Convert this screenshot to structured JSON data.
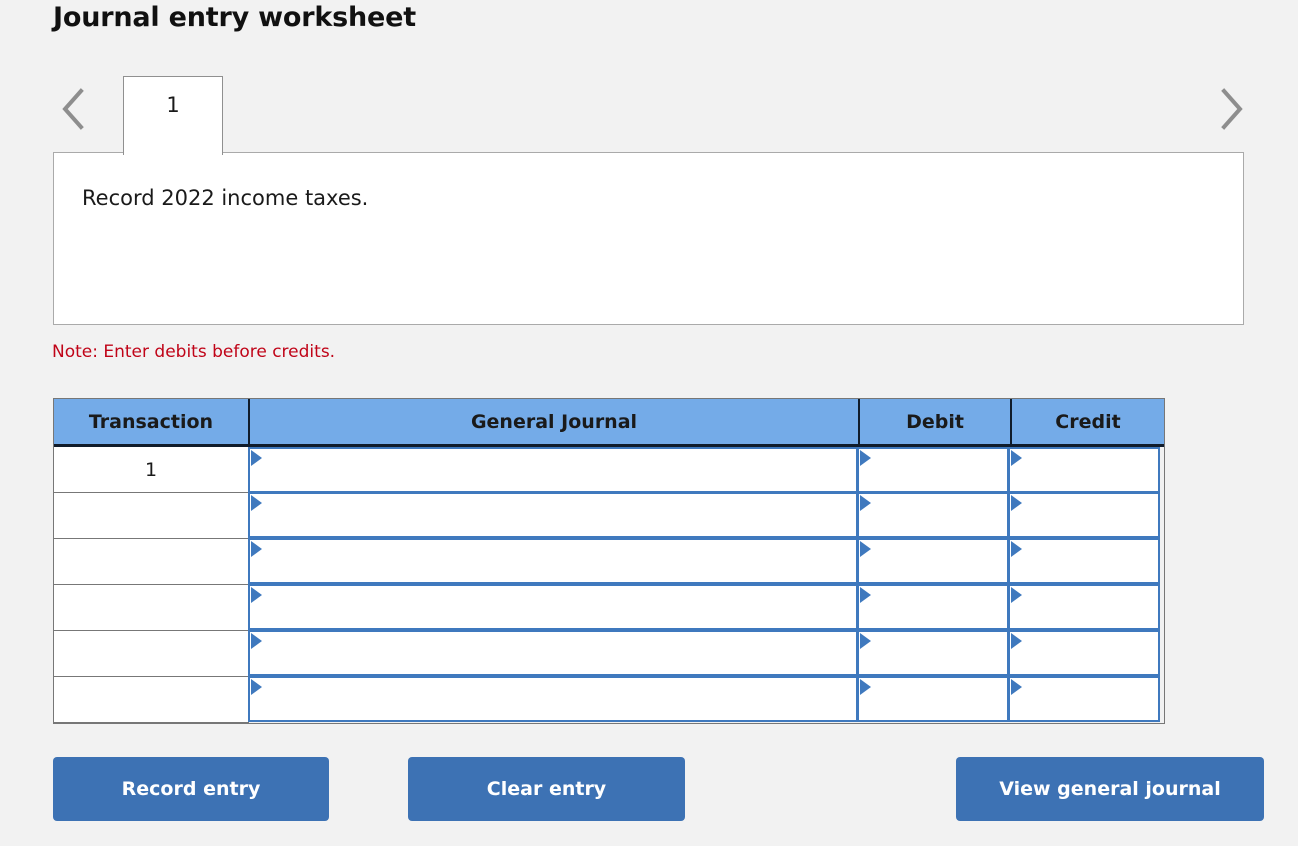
{
  "page_title": "Journal entry worksheet",
  "navigation": {
    "prev_label": "‹",
    "next_label": "›",
    "prev_icon": "chevron-left-icon",
    "next_icon": "chevron-right-icon"
  },
  "tabs": [
    {
      "label": "1",
      "active": true
    }
  ],
  "description": "Record 2022 income taxes.",
  "note": "Note: Enter debits before credits.",
  "table": {
    "headers": {
      "transaction": "Transaction",
      "general_journal": "General Journal",
      "debit": "Debit",
      "credit": "Credit"
    },
    "rows": [
      {
        "transaction": "1",
        "general_journal": "",
        "debit": "",
        "credit": ""
      },
      {
        "transaction": "",
        "general_journal": "",
        "debit": "",
        "credit": ""
      },
      {
        "transaction": "",
        "general_journal": "",
        "debit": "",
        "credit": ""
      },
      {
        "transaction": "",
        "general_journal": "",
        "debit": "",
        "credit": ""
      },
      {
        "transaction": "",
        "general_journal": "",
        "debit": "",
        "credit": ""
      },
      {
        "transaction": "",
        "general_journal": "",
        "debit": "",
        "credit": ""
      }
    ]
  },
  "buttons": {
    "record_entry": "Record entry",
    "clear_entry": "Clear entry",
    "view_general_journal": "View general journal"
  },
  "colors": {
    "page_background": "#f2f2f2",
    "header_blue": "#74abe8",
    "button_blue": "#3d72b4",
    "cell_border_blue": "#3f79be",
    "note_red": "#c00418",
    "panel_border_gray": "#aaaaaa",
    "table_border_gray": "#777777"
  }
}
